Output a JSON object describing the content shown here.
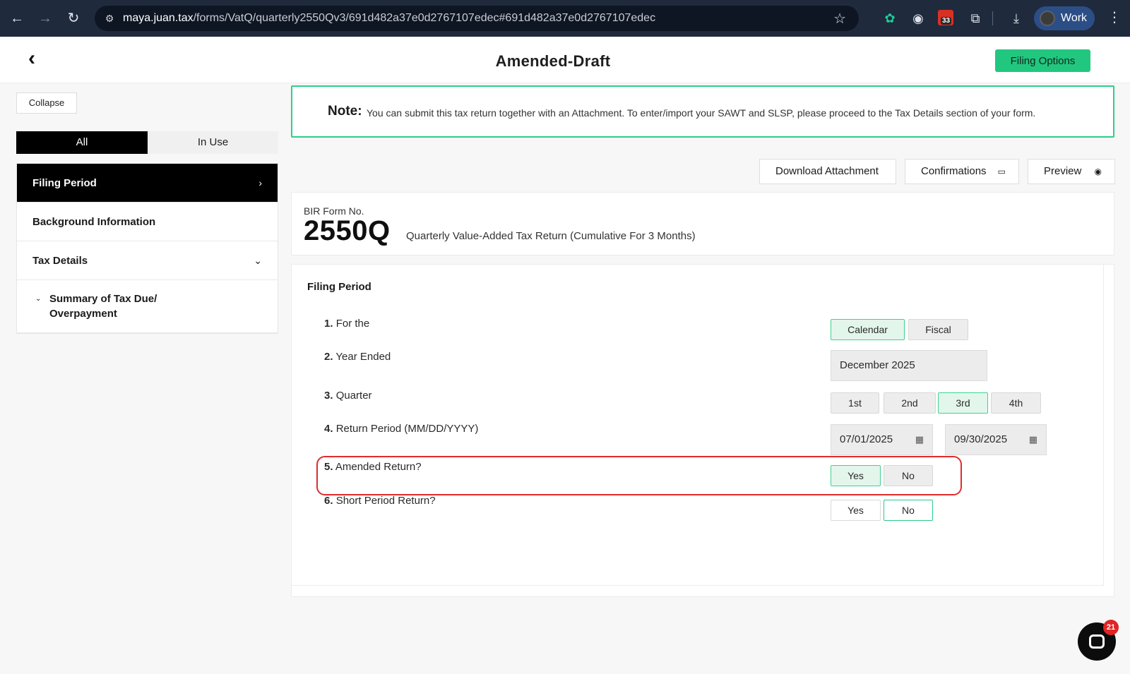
{
  "browser": {
    "url_domain": "maya.juan.tax",
    "url_path": "/forms/VatQ/quarterly2550Qv3/691d482a37e0d2767107edec#691d482a37e0d2767107edec",
    "profile_label": "Work",
    "calendar_badge": "33",
    "icons": [
      "back-arrow",
      "forward-arrow",
      "reload",
      "site-settings",
      "bookmark-star",
      "chatgpt",
      "camera",
      "calendar",
      "extensions",
      "download",
      "more-menu"
    ]
  },
  "header": {
    "title": "Amended-Draft",
    "filing_options_label": "Filing Options"
  },
  "sidebar": {
    "collapse_label": "Collapse",
    "tabs": [
      {
        "label": "All"
      },
      {
        "label": "In Use"
      }
    ],
    "items": [
      {
        "label": "Filing Period"
      },
      {
        "label": "Background Information"
      },
      {
        "label": "Tax Details"
      },
      {
        "label": "Summary of Tax Due/ Overpayment"
      }
    ]
  },
  "note": {
    "label": "Note:",
    "text": "You can submit this tax return together with an Attachment. To enter/import your SAWT and SLSP, please proceed to the Tax Details section of your form."
  },
  "toolbar": {
    "download_label": "Download Attachment",
    "confirmations_label": "Confirmations",
    "preview_label": "Preview"
  },
  "form": {
    "bir_label": "BIR Form No.",
    "number": "2550Q",
    "description": "Quarterly Value-Added Tax Return (Cumulative For 3 Months)"
  },
  "filing_period": {
    "title": "Filing Period",
    "rows": [
      {
        "num": "1.",
        "label": "For the"
      },
      {
        "num": "2.",
        "label": "Year Ended"
      },
      {
        "num": "3.",
        "label": "Quarter"
      },
      {
        "num": "4.",
        "label": "Return Period (MM/DD/YYYY)"
      },
      {
        "num": "5.",
        "label": "Amended Return?"
      },
      {
        "num": "6.",
        "label": "Short Period Return?"
      }
    ],
    "for_the_options": [
      "Calendar",
      "Fiscal"
    ],
    "for_the_selected": "Calendar",
    "year_ended": "December  2025",
    "quarter_options": [
      "1st",
      "2nd",
      "3rd",
      "4th"
    ],
    "quarter_selected": "3rd",
    "return_period_from": "07/01/2025",
    "return_period_to": "09/30/2025",
    "amended_options": [
      "Yes",
      "No"
    ],
    "amended_selected": "Yes",
    "short_period_options": [
      "Yes",
      "No"
    ],
    "short_period_selected": "No"
  },
  "chat": {
    "badge_count": "21"
  },
  "colors": {
    "browser_bg": "#1f2a3d",
    "accent_green": "#22c77f",
    "highlight_red": "#e12b2b",
    "sidebar_active": "#000000"
  }
}
